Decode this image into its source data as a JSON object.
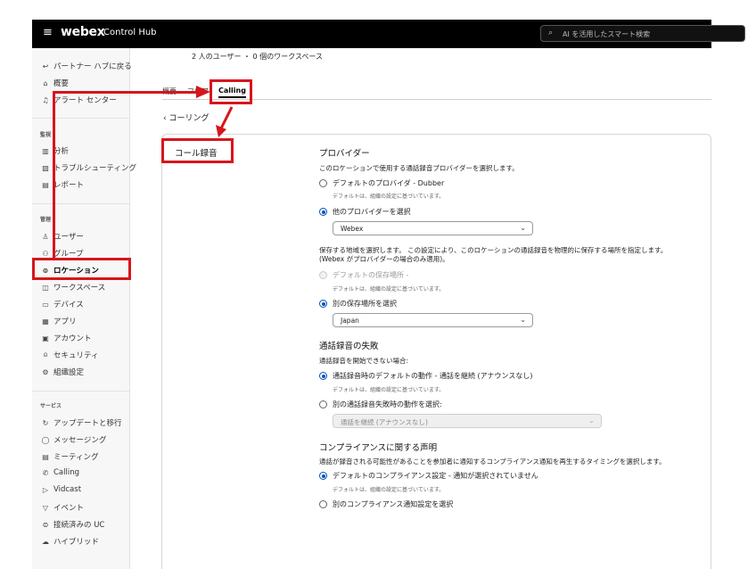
{
  "header": {
    "brand": "webex",
    "product": "Control Hub",
    "search_placeholder": "AI を活用したスマート検索"
  },
  "sidebar": {
    "top_items": [
      {
        "icon": "back-arrow-icon",
        "glyph": "↩",
        "label": "パートナー ハブに戻る"
      },
      {
        "icon": "home-icon",
        "glyph": "⌂",
        "label": "概要"
      },
      {
        "icon": "bell-icon",
        "glyph": "♫",
        "label": "アラート センター"
      }
    ],
    "monitoring_label": "監視",
    "monitoring_items": [
      {
        "icon": "chart-icon",
        "glyph": "▥",
        "label": "分析"
      },
      {
        "icon": "troubleshoot-icon",
        "glyph": "▧",
        "label": "トラブルシューティング"
      },
      {
        "icon": "report-icon",
        "glyph": "▤",
        "label": "レポート"
      }
    ],
    "management_label": "管理",
    "management_items": [
      {
        "icon": "user-icon",
        "glyph": "♙",
        "label": "ユーザー"
      },
      {
        "icon": "group-icon",
        "glyph": "⚇",
        "label": "グループ"
      },
      {
        "icon": "location-icon",
        "glyph": "⊚",
        "label": "ロケーション"
      },
      {
        "icon": "workspace-icon",
        "glyph": "◫",
        "label": "ワークスペース"
      },
      {
        "icon": "device-icon",
        "glyph": "▭",
        "label": "デバイス"
      },
      {
        "icon": "apps-icon",
        "glyph": "▦",
        "label": "アプリ"
      },
      {
        "icon": "account-icon",
        "glyph": "▣",
        "label": "アカウント"
      },
      {
        "icon": "lock-icon",
        "glyph": "⍝",
        "label": "セキュリティ"
      },
      {
        "icon": "gear-icon",
        "glyph": "⚙",
        "label": "組織設定"
      }
    ],
    "services_label": "サービス",
    "services_items": [
      {
        "icon": "refresh-icon",
        "glyph": "↻",
        "label": "アップデートと移行"
      },
      {
        "icon": "message-icon",
        "glyph": "◯",
        "label": "メッセージング"
      },
      {
        "icon": "calendar-icon",
        "glyph": "▤",
        "label": "ミーティング"
      },
      {
        "icon": "phone-icon",
        "glyph": "✆",
        "label": "Calling"
      },
      {
        "icon": "play-icon",
        "glyph": "▷",
        "label": "Vidcast"
      },
      {
        "icon": "event-icon",
        "glyph": "▽",
        "label": "イベント"
      },
      {
        "icon": "connected-uc-icon",
        "glyph": "⊜",
        "label": "接続済みの UC"
      },
      {
        "icon": "cloud-icon",
        "glyph": "☁",
        "label": "ハイブリッド"
      }
    ]
  },
  "main": {
    "user_count": "2 人のユーザー ・ 0 個のワークスペース",
    "tabs": [
      "概要",
      "フロア",
      "Calling"
    ],
    "back_label": "コーリング",
    "card_title": "コール録音",
    "provider": {
      "title": "プロバイダー",
      "desc": "このロケーションで使用する通話録音プロバイダーを選択します。",
      "option_default": "デフォルトのプロバイダ - Dubber",
      "option_default_hint": "デフォルトは、組織の設定に基づいています。",
      "option_other": "他のプロバイダーを選択",
      "provider_value": "Webex"
    },
    "storage": {
      "desc_line1": "保存する地域を選択します。 この設定により、このロケーションの通話録音を物理的に保存する場所を指定します。",
      "desc_line2": "(Webex がプロバイダーの場合のみ適用)。",
      "option_default": "デフォルトの保存場所 -",
      "option_default_hint": "デフォルトは、組織の設定に基づいています。",
      "option_other": "別の保存場所を選択",
      "region_value": "Japan"
    },
    "failure": {
      "title": "通話録音の失敗",
      "desc": "通話録音を開始できない場合:",
      "option_default": "通話録音時のデフォルトの動作 - 通話を継続 (アナウンスなし)",
      "option_default_hint": "デフォルトは、組織の設定に基づいています。",
      "option_other": "別の通話録音失敗時の動作を選択:",
      "action_value": "通話を継続 (アナウンスなし)"
    },
    "compliance": {
      "title": "コンプライアンスに関する声明",
      "desc": "通話が録音される可能性があることを参加者に通知するコンプライアンス通知を再生するタイミングを選択します。",
      "option_default": "デフォルトのコンプライアンス設定 - 通知が選択されていません",
      "option_default_hint": "デフォルトは、組織の設定に基づいています。",
      "option_other": "別のコンプライアンス通知設定を選択"
    }
  },
  "colors": {
    "highlight": "#d7151c",
    "radio_selected": "#0052bf",
    "header_bg": "#000000"
  }
}
